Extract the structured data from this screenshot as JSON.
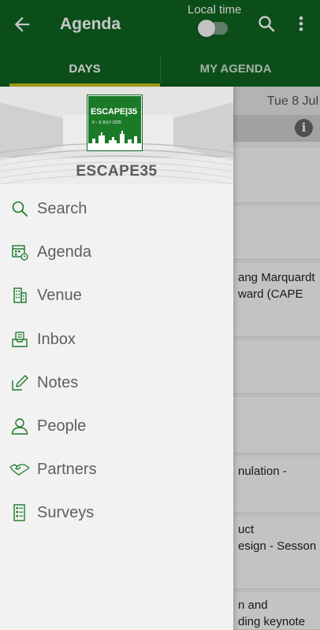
{
  "appbar": {
    "title": "Agenda",
    "local_time_label": "Local time",
    "local_time_on": false,
    "color": "#0f6420",
    "tab_indicator_color": "#d4cf1d"
  },
  "tabs": [
    {
      "label": "DAYS",
      "active": true
    },
    {
      "label": "MY AGENDA",
      "active": false
    }
  ],
  "background": {
    "date": "Tue 8 Jul",
    "cards": [
      {
        "lines": [
          "ang Marquardt",
          "ward (CAPE"
        ]
      },
      {
        "lines": [
          "nulation -"
        ]
      },
      {
        "lines": [
          "uct",
          "esign - Sesson"
        ]
      },
      {
        "lines": [
          "n and",
          "ding keynote"
        ]
      }
    ]
  },
  "drawer": {
    "logo_text": "ESCAPE|35",
    "logo_dates": "6 – 9 JULY 2025",
    "event_name": "ESCAPE35",
    "items": [
      {
        "label": "Search",
        "icon": "search-icon"
      },
      {
        "label": "Agenda",
        "icon": "calendar-icon"
      },
      {
        "label": "Venue",
        "icon": "building-icon"
      },
      {
        "label": "Inbox",
        "icon": "inbox-icon"
      },
      {
        "label": "Notes",
        "icon": "pencil-icon"
      },
      {
        "label": "People",
        "icon": "person-icon"
      },
      {
        "label": "Partners",
        "icon": "handshake-icon"
      },
      {
        "label": "Surveys",
        "icon": "checklist-icon"
      }
    ]
  }
}
